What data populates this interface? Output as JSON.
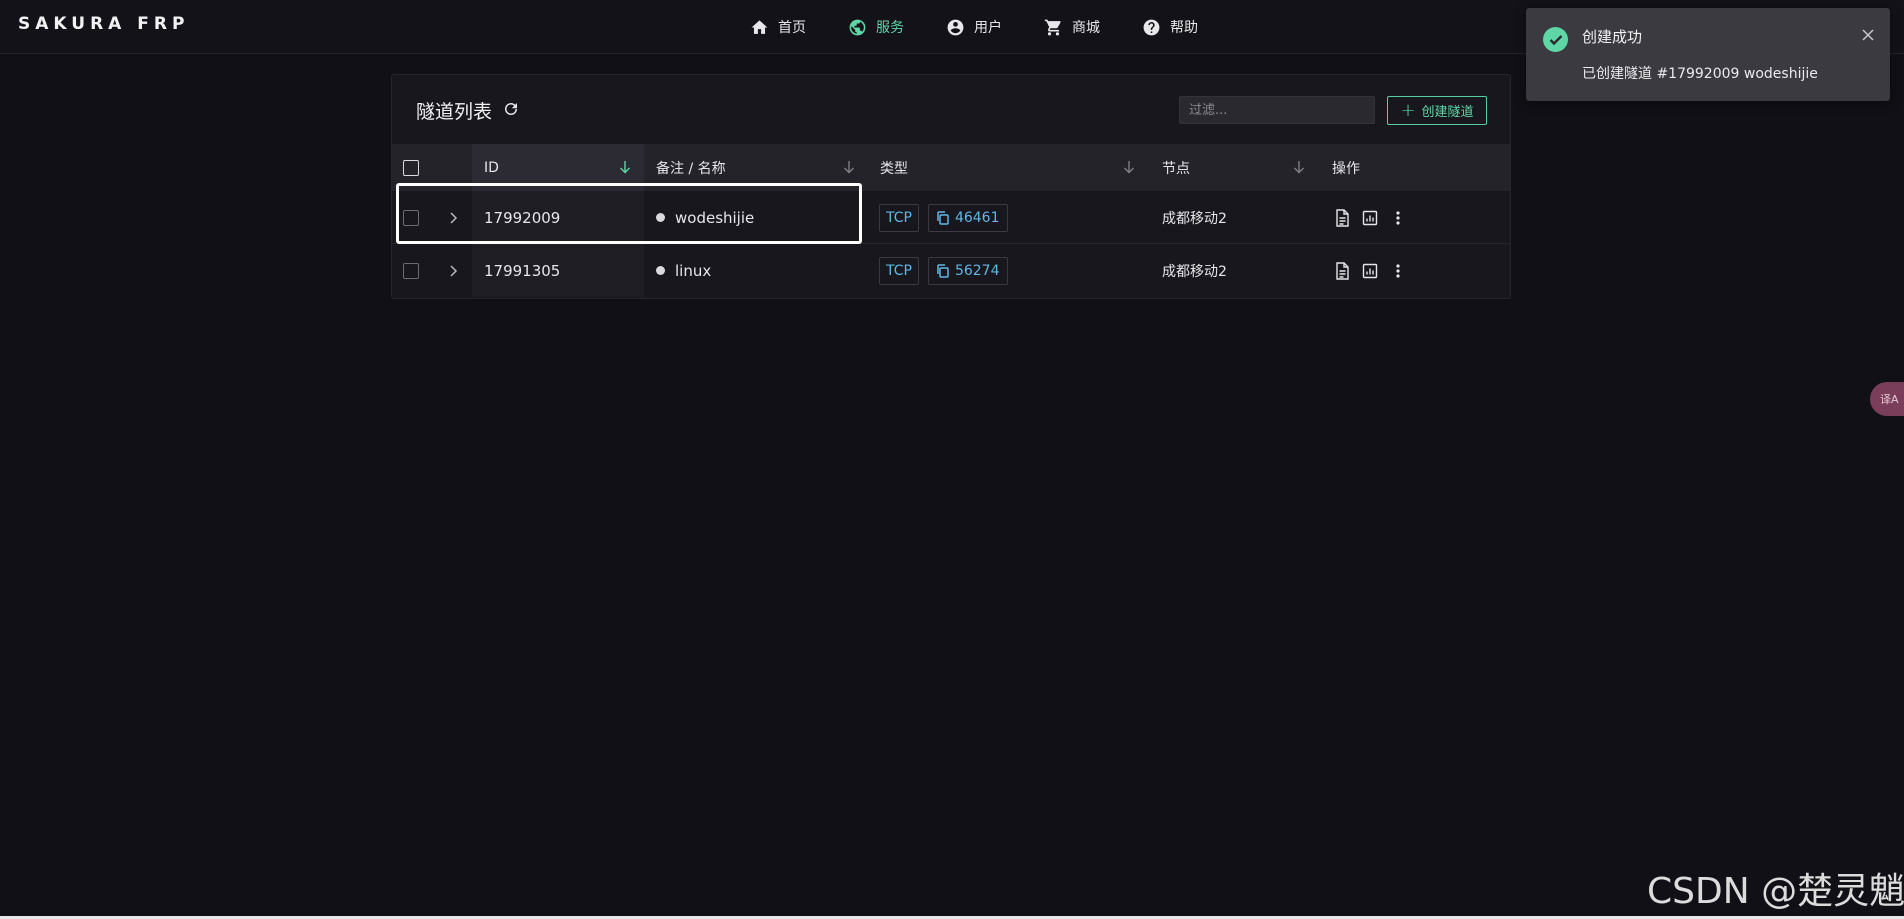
{
  "app": {
    "logo": "SAKURA FRP"
  },
  "nav": {
    "items": [
      {
        "label": "首页",
        "icon": "home-icon",
        "active": false
      },
      {
        "label": "服务",
        "icon": "globe-icon",
        "active": true
      },
      {
        "label": "用户",
        "icon": "user-circle-icon",
        "active": false
      },
      {
        "label": "商城",
        "icon": "cart-icon",
        "active": false
      },
      {
        "label": "帮助",
        "icon": "help-circle-icon",
        "active": false
      }
    ]
  },
  "card": {
    "title": "隧道列表",
    "filter_placeholder": "过滤...",
    "create_label": "创建隧道"
  },
  "table": {
    "columns": {
      "id": "ID",
      "name": "备注 / 名称",
      "type": "类型",
      "node": "节点",
      "actions": "操作"
    },
    "rows": [
      {
        "id": "17992009",
        "name": "wodeshijie",
        "type": "TCP",
        "port": "46461",
        "node": "成都移动2"
      },
      {
        "id": "17991305",
        "name": "linux",
        "type": "TCP",
        "port": "56274",
        "node": "成都移动2"
      }
    ]
  },
  "toast": {
    "title": "创建成功",
    "message": "已创建隧道 #17992009 wodeshijie"
  },
  "translate_button": "译A",
  "watermark": "CSDN @楚灵魈",
  "colors": {
    "accent": "#5fd6a6",
    "tag_blue": "#62b6e6",
    "background": "#111016"
  }
}
